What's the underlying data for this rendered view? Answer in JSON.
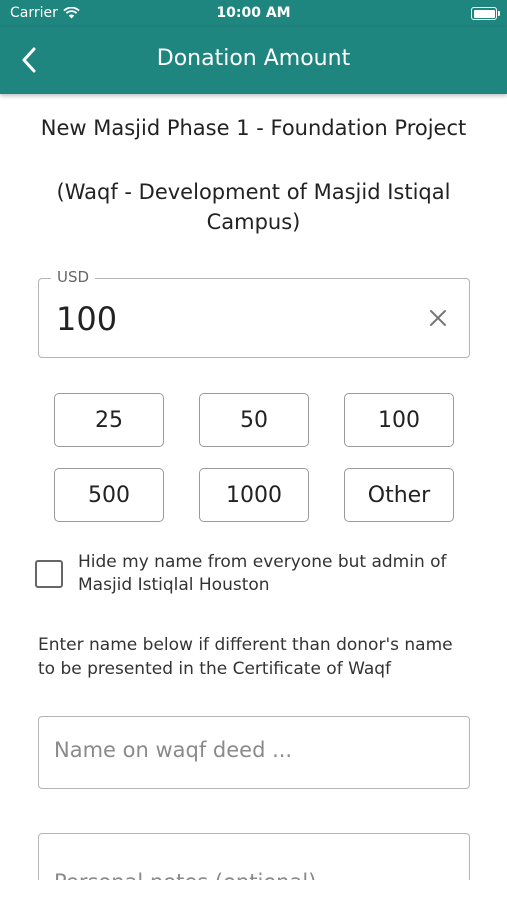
{
  "status_bar": {
    "carrier": "Carrier",
    "time": "10:00 AM"
  },
  "nav": {
    "title": "Donation Amount"
  },
  "project": {
    "title": "New Masjid Phase 1 - Foundation Project",
    "subtitle": "(Waqf - Development of Masjid Istiqal Campus)"
  },
  "amount": {
    "currency_label": "USD",
    "value": "100"
  },
  "presets": [
    "25",
    "50",
    "100",
    "500",
    "1000",
    "Other"
  ],
  "hide_name": {
    "checked": false,
    "label": "Hide my name from everyone but admin of Masjid Istiqlal Houston"
  },
  "certificate": {
    "instruction": "Enter name below if different than donor's name to be presented in the Certificate of Waqf",
    "name_placeholder": "Name on waqf deed ...",
    "notes_placeholder": "Personal notes (optional)"
  },
  "colors": {
    "header": "#1f857f"
  },
  "icons": [
    "wifi-icon",
    "battery-icon",
    "back-chevron-icon",
    "clear-icon"
  ]
}
